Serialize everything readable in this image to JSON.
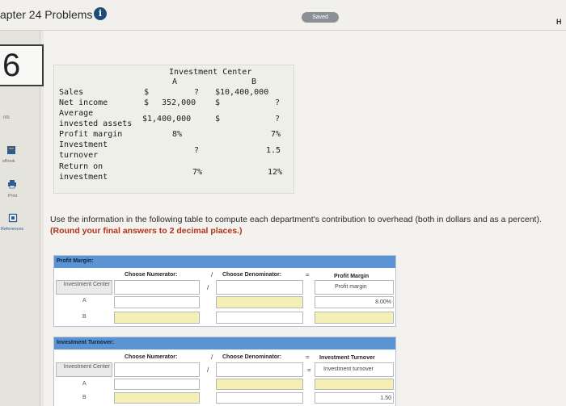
{
  "header": {
    "title": "apter 24 Problems",
    "saved": "Saved",
    "help": "H"
  },
  "rail": {
    "question_number": "6",
    "points_label": "nts",
    "ebook": "eBook",
    "print": "Print",
    "references": "References"
  },
  "investment_table": {
    "title": "Investment Center",
    "col_a": "A",
    "col_b": "B",
    "rows": [
      {
        "label": "Sales",
        "a_prefix": "$",
        "a": "?",
        "b": "$10,400,000"
      },
      {
        "label": "Net income",
        "a_prefix": "$",
        "a": "352,000",
        "b_prefix": "$",
        "b": "?"
      },
      {
        "label1": "Average",
        "label2": "invested assets",
        "a": "$1,400,000",
        "b_prefix": "$",
        "b": "?"
      },
      {
        "label": "Profit margin",
        "a": "8%",
        "b": "7%"
      },
      {
        "label1": "Investment",
        "label2": "turnover",
        "a": "?",
        "b": "1.5"
      },
      {
        "label1": "Return on",
        "label2": "investment",
        "a": "7%",
        "b": "12%"
      }
    ]
  },
  "instruction": {
    "text": "Use the information in the following table to compute each department's contribution to overhead (both in dollars and as a percent).",
    "bold": "(Round your final answers to 2 decimal places.)"
  },
  "profit_margin_table": {
    "title": "Profit Margin:",
    "numerator": "Choose Numerator:",
    "slash": "/",
    "denominator": "Choose Denominator:",
    "equals": "=",
    "result_header": "Profit Margin",
    "result_sub": "Profit margin",
    "row_label": "Investment Center",
    "row_a": "A",
    "row_b": "B",
    "value_a": "8.00%"
  },
  "turnover_table": {
    "title": "Investment Turnover:",
    "numerator": "Choose Numerator:",
    "slash": "/",
    "denominator": "Choose Denominator:",
    "equals": "=",
    "result_header": "Investment Turnover",
    "result_sub": "Investment turnover",
    "row_label": "Investment Center",
    "row_a": "A",
    "row_b": "B",
    "value_b": "1.50"
  },
  "colors": {
    "table_header": "#5b93d3",
    "highlight": "#f4efb5",
    "instruction_bold": "#b3321b"
  }
}
